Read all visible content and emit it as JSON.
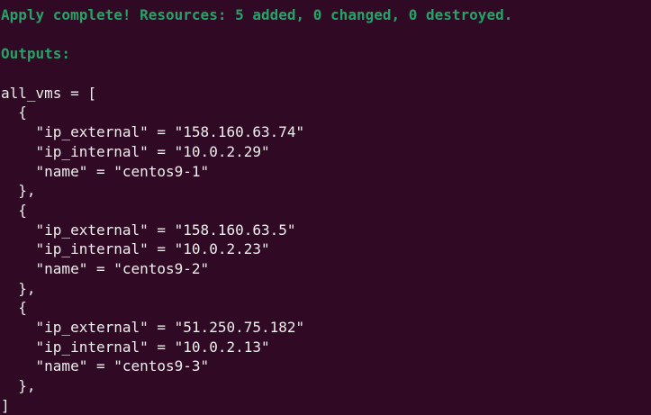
{
  "summary": "Apply complete! Resources: 5 added, 0 changed, 0 destroyed.",
  "outputs_label": "Outputs:",
  "output_name": "all_vms = [",
  "vms": [
    {
      "ip_external": "158.160.63.74",
      "ip_internal": "10.0.2.29",
      "name": "centos9-1"
    },
    {
      "ip_external": "158.160.63.5",
      "ip_internal": "10.0.2.23",
      "name": "centos9-2"
    },
    {
      "ip_external": "51.250.75.182",
      "ip_internal": "10.0.2.13",
      "name": "centos9-3"
    }
  ],
  "closing": "]",
  "colors": {
    "background": "#300a24",
    "success": "#26a269",
    "text": "#eeeeec"
  }
}
